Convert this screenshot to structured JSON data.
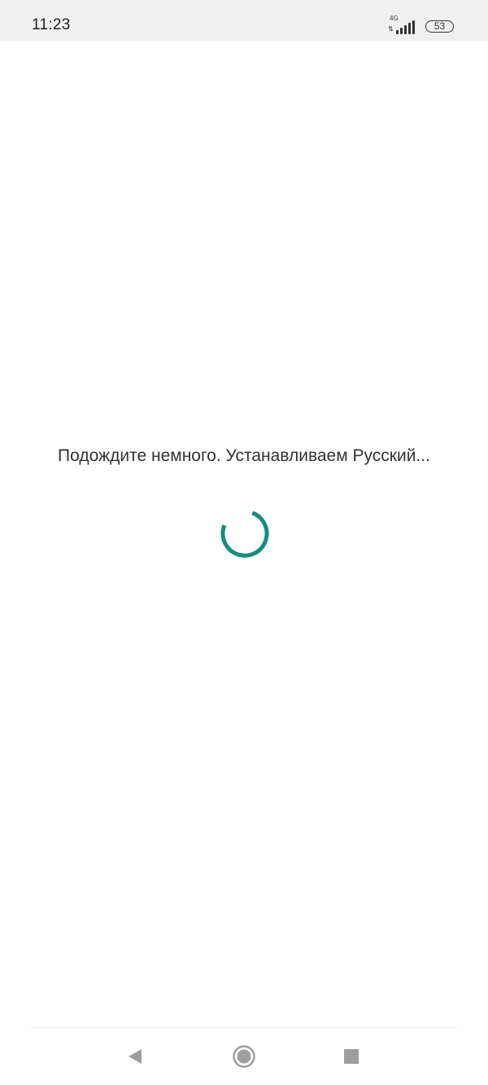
{
  "status_bar": {
    "time": "11:23",
    "network_type": "4G",
    "network_activity": "⇅",
    "battery_level": "53",
    "signal_icon": "signal-bars-icon",
    "battery_icon": "battery-icon"
  },
  "main": {
    "message": "Подождите немного. Устанавливаем Русский...",
    "spinner_icon": "loading-spinner-icon"
  },
  "nav_bar": {
    "back_icon": "back-triangle-icon",
    "home_icon": "home-circle-icon",
    "recents_icon": "recents-square-icon"
  },
  "colors": {
    "status_bar_bg": "#f0f0f0",
    "background": "#ffffff",
    "text": "#333333",
    "spinner": "#168d7d",
    "nav_icons": "#9e9e9e"
  }
}
